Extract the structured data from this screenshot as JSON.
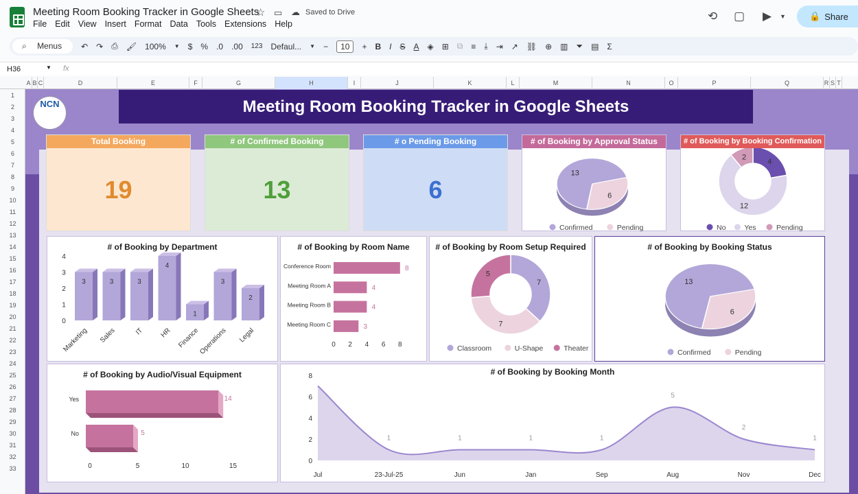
{
  "doc": {
    "title": "Meeting Room Booking Tracker in Google Sheets",
    "saved": "Saved to Drive"
  },
  "menu": [
    "File",
    "Edit",
    "View",
    "Insert",
    "Format",
    "Data",
    "Tools",
    "Extensions",
    "Help"
  ],
  "share": "Share",
  "toolbar": {
    "search": "Menus",
    "zoom": "100%",
    "currency": "$",
    "percent": "%",
    "dec_minus": ".0",
    "dec_plus": ".00",
    "numfmt": "123",
    "font": "Defaul...",
    "font_size": "10",
    "bold": "B",
    "italic": "I"
  },
  "formula": {
    "cell": "H36",
    "fx": "fx"
  },
  "columns": [
    "A",
    "B",
    "C",
    "D",
    "E",
    "F",
    "G",
    "H",
    "I",
    "J",
    "K",
    "L",
    "M",
    "N",
    "O",
    "P",
    "Q",
    "R",
    "S",
    "T"
  ],
  "rows": [
    "1",
    "2",
    "3",
    "4",
    "5",
    "6",
    "7",
    "8",
    "9",
    "10",
    "11",
    "12",
    "13",
    "14",
    "15",
    "16",
    "17",
    "18",
    "19",
    "20",
    "21",
    "22",
    "23",
    "24",
    "25",
    "26",
    "27",
    "28",
    "29",
    "30",
    "31",
    "32",
    "33"
  ],
  "dashboard": {
    "banner": "Meeting Room Booking Tracker in Google Sheets",
    "logo_text": "NCN",
    "kpis": [
      {
        "label": "Total Booking",
        "value": "19",
        "head": "#f4a85e",
        "bg": "#fde7d1",
        "color": "#e08b2e"
      },
      {
        "label": "# of Confirmed Booking",
        "value": "13",
        "head": "#8fc77d",
        "bg": "#dcebd6",
        "color": "#4f9f3b"
      },
      {
        "label": "# o Pending Booking",
        "value": "6",
        "head": "#6b9be8",
        "bg": "#cfdcf5",
        "color": "#3c6fd0"
      }
    ],
    "approval": {
      "label": "# of Booking by Approval Status",
      "head": "#c46a9a"
    },
    "confirmation": {
      "label": "# of Booking by Booking Confirmation",
      "head": "#e05a5a"
    },
    "dept_title": "# of Booking  by Department",
    "room_title": "# of Booking by Room Name",
    "setup_title": "# of Booking by Room Setup Required",
    "status_title": "# of Booking by Booking Status",
    "av_title": "# of Booking by Audio/Visual Equipment",
    "month_title": "# of Booking by Booking Month"
  },
  "chart_data": [
    {
      "type": "pie",
      "title": "# of Booking by Approval Status",
      "labels": [
        "Confirmed",
        "Pending"
      ],
      "values": [
        13,
        6
      ],
      "colors": [
        "#b3a7d9",
        "#ecd3de"
      ]
    },
    {
      "type": "pie",
      "title": "# of Booking by Booking Confirmation",
      "labels": [
        "No",
        "Yes",
        "Pending"
      ],
      "values": [
        4,
        12,
        2
      ],
      "colors": [
        "#6a4fae",
        "#ddd5eb",
        "#d19ab7"
      ]
    },
    {
      "type": "bar",
      "title": "# of Booking  by Department",
      "categories": [
        "Marketing",
        "Sales",
        "IT",
        "HR",
        "Finance",
        "Operations",
        "Legal"
      ],
      "values": [
        3,
        3,
        3,
        4,
        1,
        3,
        2
      ],
      "ylim": [
        0,
        4
      ],
      "yticks": [
        "0",
        "1",
        "2",
        "3",
        "4"
      ]
    },
    {
      "type": "bar",
      "title": "# of Booking by Room Name",
      "categories": [
        "Conference Room",
        "Meeting Room A",
        "Meeting Room B",
        "Meeting Room C"
      ],
      "values": [
        8,
        4,
        4,
        3
      ],
      "xlim": [
        0,
        8
      ],
      "xticks": [
        "0",
        "2",
        "4",
        "6",
        "8"
      ]
    },
    {
      "type": "pie",
      "title": "# of Booking by Room Setup Required",
      "labels": [
        "Classroom",
        "U-Shape",
        "Theater"
      ],
      "values": [
        7,
        7,
        5
      ],
      "colors": [
        "#b3a7d9",
        "#ecd3de",
        "#c5739e"
      ]
    },
    {
      "type": "pie",
      "title": "# of Booking by Booking Status",
      "labels": [
        "Confirmed",
        "Pending"
      ],
      "values": [
        13,
        6
      ],
      "colors": [
        "#b3a7d9",
        "#ecd3de"
      ]
    },
    {
      "type": "bar",
      "title": "# of Booking by Audio/Visual Equipment",
      "categories": [
        "Yes",
        "No"
      ],
      "values": [
        14,
        5
      ],
      "xlim": [
        0,
        15
      ],
      "xticks": [
        "0",
        "5",
        "10",
        "15"
      ]
    },
    {
      "type": "area",
      "title": "# of Booking by Booking Month",
      "x": [
        "Jul",
        "23-Jul-25",
        "Jun",
        "Jan",
        "Sep",
        "Aug",
        "Nov",
        "Dec"
      ],
      "values": [
        7,
        1,
        1,
        1,
        1,
        5,
        2,
        1
      ],
      "labels": [
        "",
        "1",
        "1",
        "1",
        "1",
        "5",
        "2",
        "1"
      ],
      "ylim": [
        0,
        8
      ],
      "yticks": [
        "0",
        "2",
        "4",
        "6",
        "8"
      ]
    }
  ]
}
